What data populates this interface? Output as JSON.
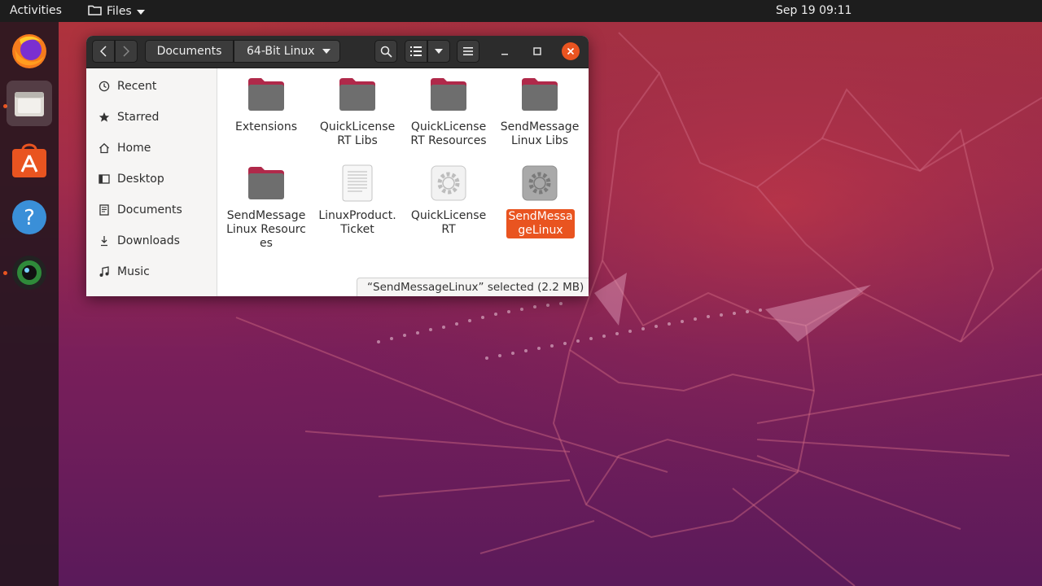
{
  "topbar": {
    "activities": "Activities",
    "app_name": "Files",
    "clock": "Sep 19  09:11"
  },
  "dock": {
    "items": [
      "firefox",
      "files",
      "software",
      "help",
      "camera"
    ]
  },
  "window": {
    "breadcrumb": [
      "Documents",
      "64-Bit Linux"
    ],
    "sidebar": [
      "Recent",
      "Starred",
      "Home",
      "Desktop",
      "Documents",
      "Downloads",
      "Music"
    ],
    "files": [
      {
        "name": "Extensions",
        "type": "folder"
      },
      {
        "name": "QuickLicenseRT Libs",
        "type": "folder"
      },
      {
        "name": "QuickLicenseRT Resources",
        "type": "folder"
      },
      {
        "name": "SendMessageLinux Libs",
        "type": "folder"
      },
      {
        "name": "SendMessageLinux Resources",
        "type": "folder"
      },
      {
        "name": "LinuxProduct.Ticket",
        "type": "text"
      },
      {
        "name": "QuickLicenseRT",
        "type": "executable"
      },
      {
        "name": "SendMessageLinux",
        "type": "executable",
        "selected": true
      }
    ],
    "status": "“SendMessageLinux” selected  (2.2 MB)"
  },
  "colors": {
    "accent": "#e95420",
    "folder_body": "#6e6e6e",
    "folder_tab": "#b0294a"
  }
}
